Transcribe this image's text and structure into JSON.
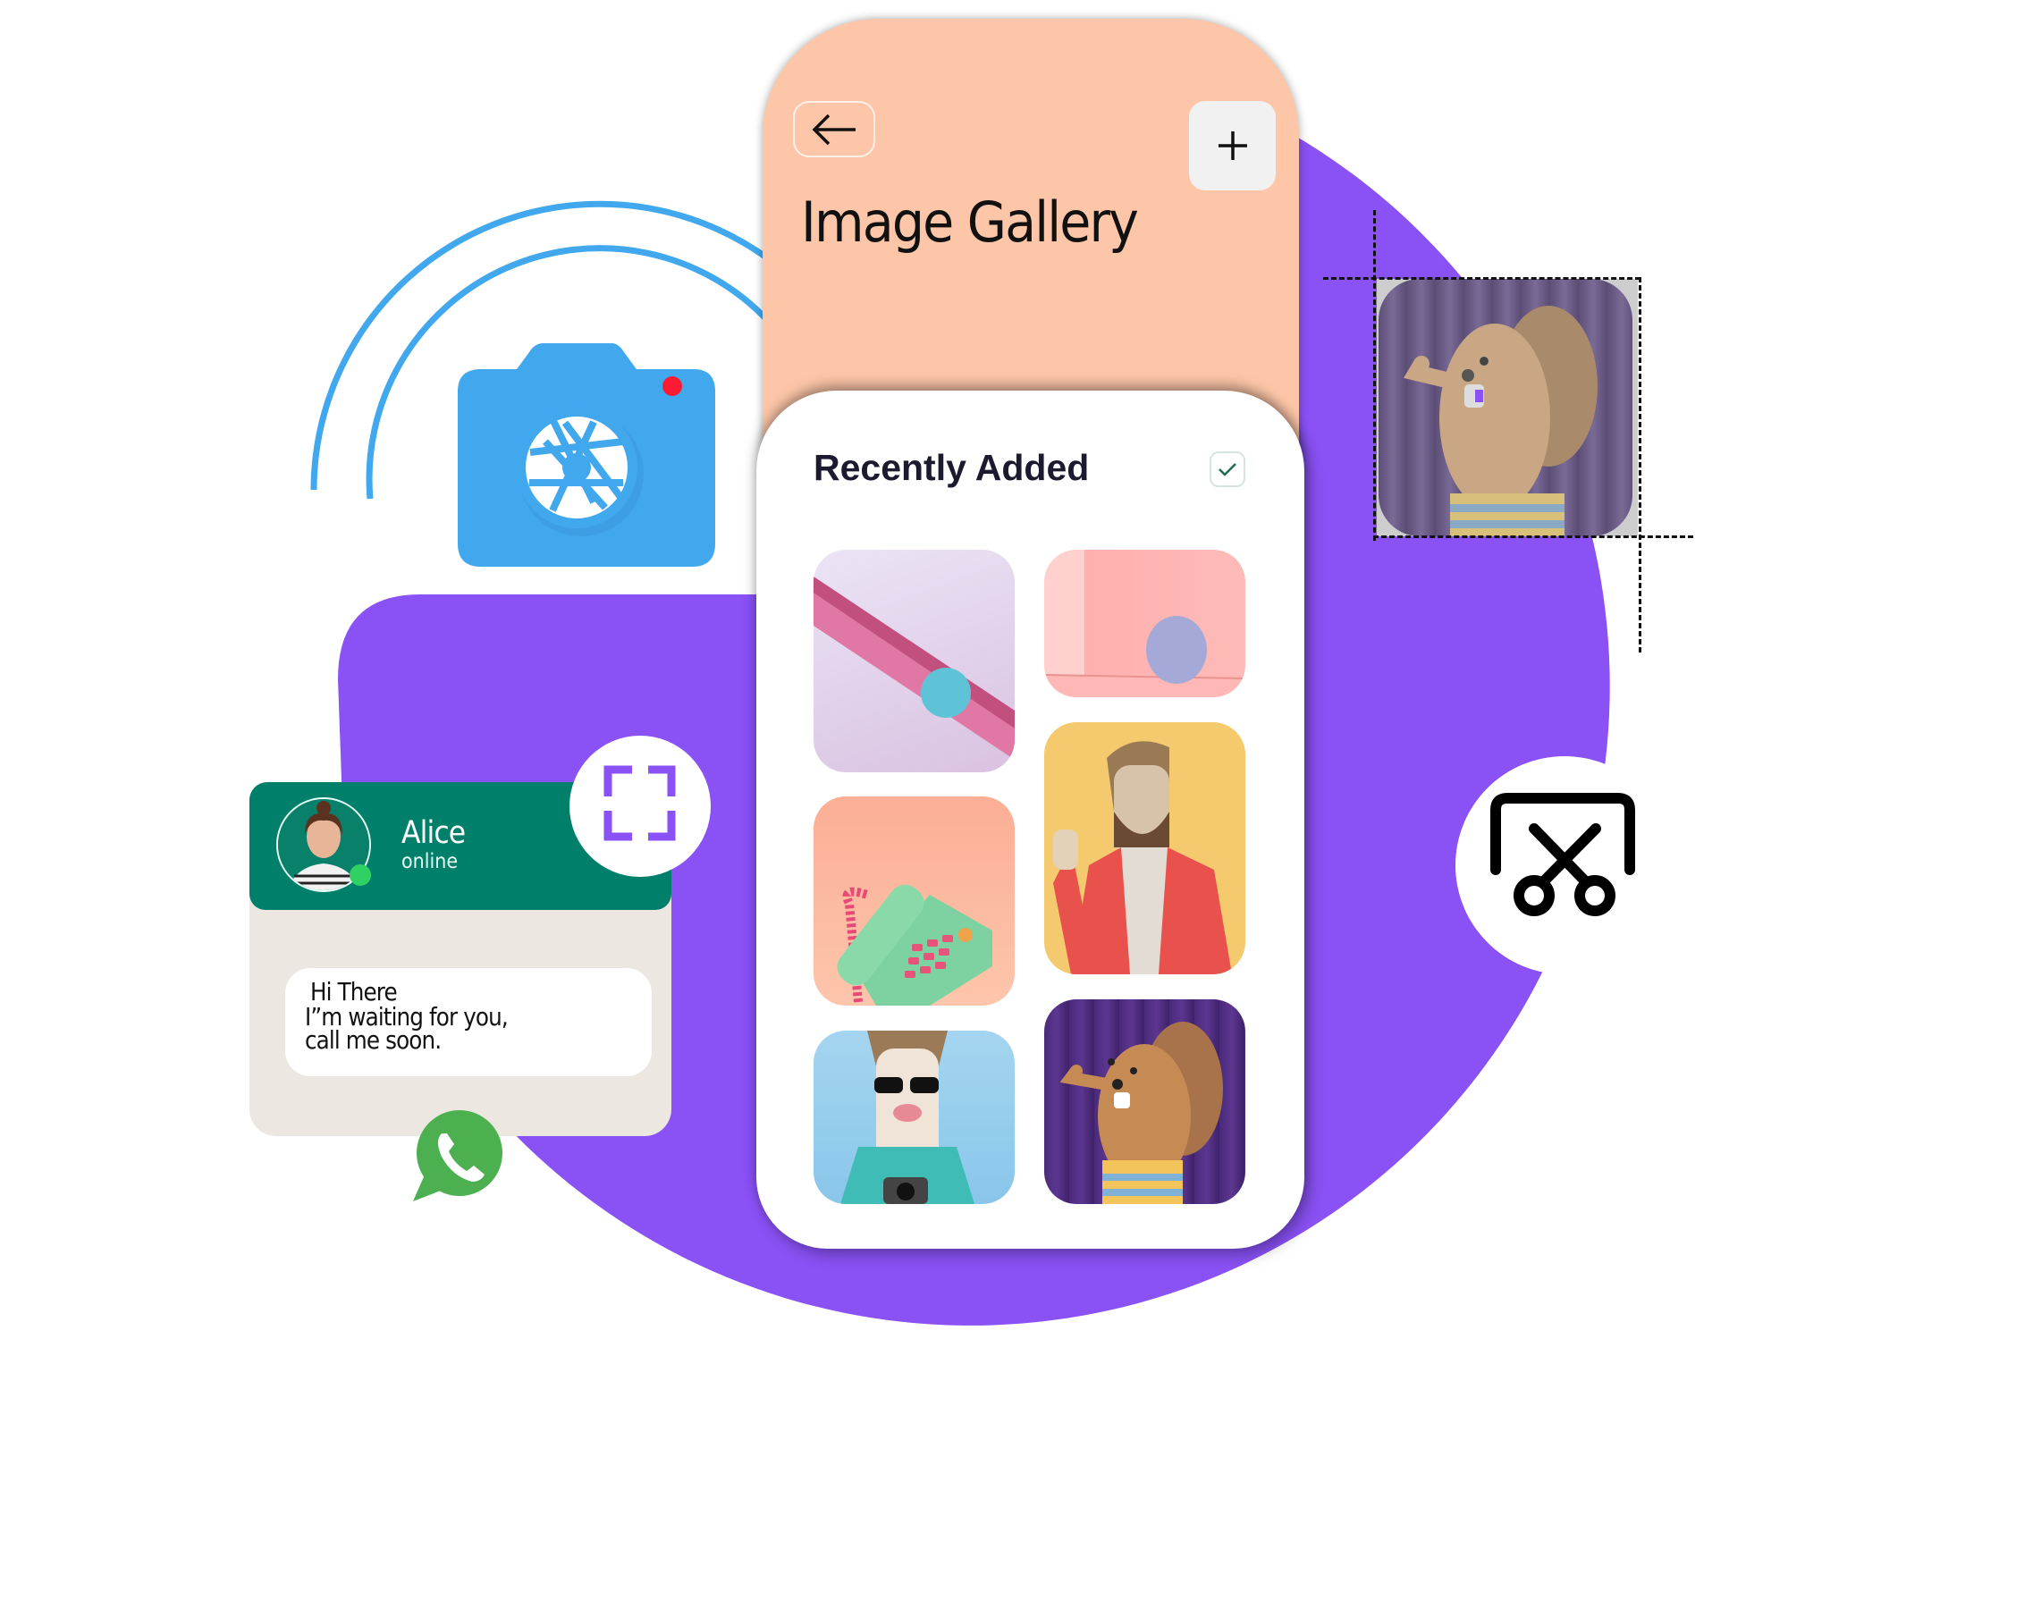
{
  "colors": {
    "purple": "#8a51f5",
    "peach": "#fdc6a8",
    "camera_blue": "#41a8ee",
    "record_red": "#ff1a33",
    "whatsapp_green": "#4caf50",
    "chat_header_green": "#00806a",
    "online_green": "#2fd163",
    "check_green": "#1f6b4f"
  },
  "gallery_app": {
    "title": "Image Gallery",
    "back_icon": "arrow-left-icon",
    "add_icon": "plus-icon",
    "section_title": "Recently Added",
    "select_icon": "checkmark-icon",
    "thumbnails": [
      {
        "name": "pink-slide-ball",
        "description": "teal ball rolling down a pink diagonal slide"
      },
      {
        "name": "lavender-ball",
        "description": "lavender ball on pink floor"
      },
      {
        "name": "waving-man",
        "description": "3D bearded man in red coat waving"
      },
      {
        "name": "green-telephone",
        "description": "mint green retro telephone with pink cord"
      },
      {
        "name": "sunglasses-guy",
        "description": "3D guy with sunglasses holding a camera"
      },
      {
        "name": "beaver",
        "description": "3D beaver character on striped pedestal"
      }
    ]
  },
  "chat": {
    "contact_name": "Alice",
    "status": "online",
    "message_line1": "Hi There",
    "message_line2": "I”m waiting for you,",
    "message_line3": "call me soon.",
    "app_icon": "whatsapp-icon"
  },
  "floating_icons": {
    "camera": "camera-icon",
    "fullscreen": "fullscreen-icon",
    "crop_cut": "scissors-crop-icon",
    "cropped_image": "beaver"
  }
}
